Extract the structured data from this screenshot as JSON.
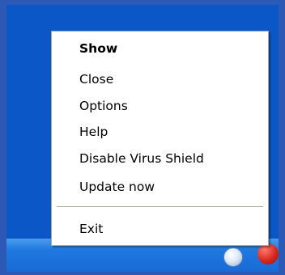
{
  "menu": {
    "items": [
      {
        "label": "Show"
      },
      {
        "label": "Close"
      },
      {
        "label": "Options"
      },
      {
        "label": "Help"
      },
      {
        "label": "Disable Virus Shield"
      },
      {
        "label": "Update now"
      }
    ],
    "exit_label": "Exit"
  },
  "tray": {
    "icons": [
      "tray-icon",
      "antivirus-icon"
    ]
  },
  "colors": {
    "desktop": "#0c57c7",
    "taskbar": "#1e78df",
    "menu_bg": "#ffffff",
    "menu_border": "#aca899"
  }
}
